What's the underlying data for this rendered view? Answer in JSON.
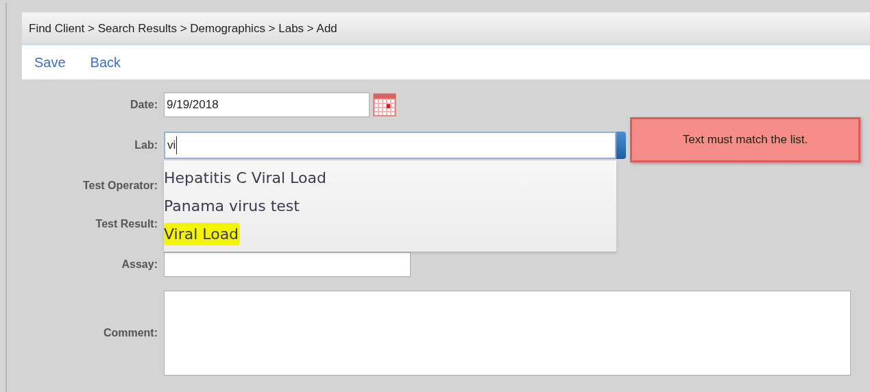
{
  "breadcrumb": "Find Client > Search Results > Demographics > Labs > Add",
  "toolbar": [
    "Save",
    "Back"
  ],
  "form": {
    "date": {
      "label": "Date:",
      "value": "9/19/2018"
    },
    "lab": {
      "label": "Lab:",
      "value": "vi",
      "tooltip": "Text must match the list.",
      "suggestions": [
        {
          "text": "Hepatitis C Viral Load",
          "highlighted": false
        },
        {
          "text": "Panama virus test",
          "highlighted": false
        },
        {
          "text": "Viral Load",
          "highlighted": true
        }
      ]
    },
    "test_operator": {
      "label": "Test Operator:"
    },
    "test_result": {
      "label": "Test Result:"
    },
    "assay": {
      "label": "Assay:"
    },
    "comment": {
      "label": "Comment:"
    }
  }
}
